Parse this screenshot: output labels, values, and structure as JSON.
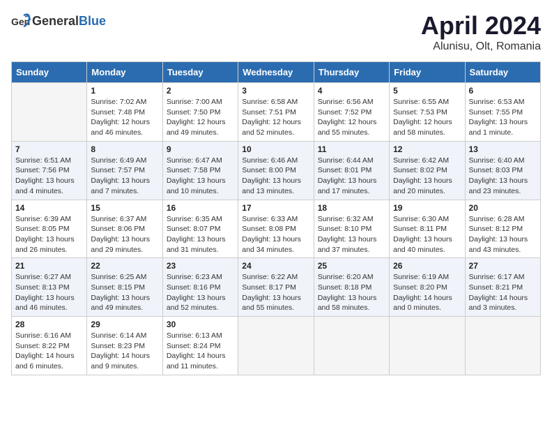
{
  "header": {
    "logo_general": "General",
    "logo_blue": "Blue",
    "title": "April 2024",
    "subtitle": "Alunisu, Olt, Romania"
  },
  "days_of_week": [
    "Sunday",
    "Monday",
    "Tuesday",
    "Wednesday",
    "Thursday",
    "Friday",
    "Saturday"
  ],
  "weeks": [
    [
      {
        "day": "",
        "lines": []
      },
      {
        "day": "1",
        "lines": [
          "Sunrise: 7:02 AM",
          "Sunset: 7:48 PM",
          "Daylight: 12 hours",
          "and 46 minutes."
        ]
      },
      {
        "day": "2",
        "lines": [
          "Sunrise: 7:00 AM",
          "Sunset: 7:50 PM",
          "Daylight: 12 hours",
          "and 49 minutes."
        ]
      },
      {
        "day": "3",
        "lines": [
          "Sunrise: 6:58 AM",
          "Sunset: 7:51 PM",
          "Daylight: 12 hours",
          "and 52 minutes."
        ]
      },
      {
        "day": "4",
        "lines": [
          "Sunrise: 6:56 AM",
          "Sunset: 7:52 PM",
          "Daylight: 12 hours",
          "and 55 minutes."
        ]
      },
      {
        "day": "5",
        "lines": [
          "Sunrise: 6:55 AM",
          "Sunset: 7:53 PM",
          "Daylight: 12 hours",
          "and 58 minutes."
        ]
      },
      {
        "day": "6",
        "lines": [
          "Sunrise: 6:53 AM",
          "Sunset: 7:55 PM",
          "Daylight: 13 hours",
          "and 1 minute."
        ]
      }
    ],
    [
      {
        "day": "7",
        "lines": [
          "Sunrise: 6:51 AM",
          "Sunset: 7:56 PM",
          "Daylight: 13 hours",
          "and 4 minutes."
        ]
      },
      {
        "day": "8",
        "lines": [
          "Sunrise: 6:49 AM",
          "Sunset: 7:57 PM",
          "Daylight: 13 hours",
          "and 7 minutes."
        ]
      },
      {
        "day": "9",
        "lines": [
          "Sunrise: 6:47 AM",
          "Sunset: 7:58 PM",
          "Daylight: 13 hours",
          "and 10 minutes."
        ]
      },
      {
        "day": "10",
        "lines": [
          "Sunrise: 6:46 AM",
          "Sunset: 8:00 PM",
          "Daylight: 13 hours",
          "and 13 minutes."
        ]
      },
      {
        "day": "11",
        "lines": [
          "Sunrise: 6:44 AM",
          "Sunset: 8:01 PM",
          "Daylight: 13 hours",
          "and 17 minutes."
        ]
      },
      {
        "day": "12",
        "lines": [
          "Sunrise: 6:42 AM",
          "Sunset: 8:02 PM",
          "Daylight: 13 hours",
          "and 20 minutes."
        ]
      },
      {
        "day": "13",
        "lines": [
          "Sunrise: 6:40 AM",
          "Sunset: 8:03 PM",
          "Daylight: 13 hours",
          "and 23 minutes."
        ]
      }
    ],
    [
      {
        "day": "14",
        "lines": [
          "Sunrise: 6:39 AM",
          "Sunset: 8:05 PM",
          "Daylight: 13 hours",
          "and 26 minutes."
        ]
      },
      {
        "day": "15",
        "lines": [
          "Sunrise: 6:37 AM",
          "Sunset: 8:06 PM",
          "Daylight: 13 hours",
          "and 29 minutes."
        ]
      },
      {
        "day": "16",
        "lines": [
          "Sunrise: 6:35 AM",
          "Sunset: 8:07 PM",
          "Daylight: 13 hours",
          "and 31 minutes."
        ]
      },
      {
        "day": "17",
        "lines": [
          "Sunrise: 6:33 AM",
          "Sunset: 8:08 PM",
          "Daylight: 13 hours",
          "and 34 minutes."
        ]
      },
      {
        "day": "18",
        "lines": [
          "Sunrise: 6:32 AM",
          "Sunset: 8:10 PM",
          "Daylight: 13 hours",
          "and 37 minutes."
        ]
      },
      {
        "day": "19",
        "lines": [
          "Sunrise: 6:30 AM",
          "Sunset: 8:11 PM",
          "Daylight: 13 hours",
          "and 40 minutes."
        ]
      },
      {
        "day": "20",
        "lines": [
          "Sunrise: 6:28 AM",
          "Sunset: 8:12 PM",
          "Daylight: 13 hours",
          "and 43 minutes."
        ]
      }
    ],
    [
      {
        "day": "21",
        "lines": [
          "Sunrise: 6:27 AM",
          "Sunset: 8:13 PM",
          "Daylight: 13 hours",
          "and 46 minutes."
        ]
      },
      {
        "day": "22",
        "lines": [
          "Sunrise: 6:25 AM",
          "Sunset: 8:15 PM",
          "Daylight: 13 hours",
          "and 49 minutes."
        ]
      },
      {
        "day": "23",
        "lines": [
          "Sunrise: 6:23 AM",
          "Sunset: 8:16 PM",
          "Daylight: 13 hours",
          "and 52 minutes."
        ]
      },
      {
        "day": "24",
        "lines": [
          "Sunrise: 6:22 AM",
          "Sunset: 8:17 PM",
          "Daylight: 13 hours",
          "and 55 minutes."
        ]
      },
      {
        "day": "25",
        "lines": [
          "Sunrise: 6:20 AM",
          "Sunset: 8:18 PM",
          "Daylight: 13 hours",
          "and 58 minutes."
        ]
      },
      {
        "day": "26",
        "lines": [
          "Sunrise: 6:19 AM",
          "Sunset: 8:20 PM",
          "Daylight: 14 hours",
          "and 0 minutes."
        ]
      },
      {
        "day": "27",
        "lines": [
          "Sunrise: 6:17 AM",
          "Sunset: 8:21 PM",
          "Daylight: 14 hours",
          "and 3 minutes."
        ]
      }
    ],
    [
      {
        "day": "28",
        "lines": [
          "Sunrise: 6:16 AM",
          "Sunset: 8:22 PM",
          "Daylight: 14 hours",
          "and 6 minutes."
        ]
      },
      {
        "day": "29",
        "lines": [
          "Sunrise: 6:14 AM",
          "Sunset: 8:23 PM",
          "Daylight: 14 hours",
          "and 9 minutes."
        ]
      },
      {
        "day": "30",
        "lines": [
          "Sunrise: 6:13 AM",
          "Sunset: 8:24 PM",
          "Daylight: 14 hours",
          "and 11 minutes."
        ]
      },
      {
        "day": "",
        "lines": []
      },
      {
        "day": "",
        "lines": []
      },
      {
        "day": "",
        "lines": []
      },
      {
        "day": "",
        "lines": []
      }
    ]
  ]
}
